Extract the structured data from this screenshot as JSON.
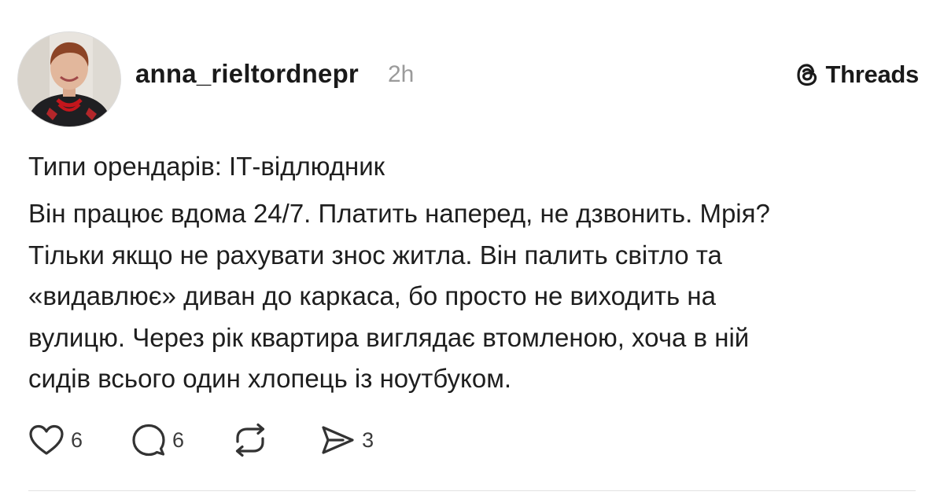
{
  "post": {
    "author": {
      "username": "anna_rieltordnepr",
      "time_ago": "2h"
    },
    "brand": {
      "label": "Threads",
      "icon": "threads-logo-icon"
    },
    "title": "Типи орендарів: ІТ-відлюдник",
    "body_lines": [
      "Він працює вдома 24/7. Платить наперед, не дзвонить. Мрія?",
      "Тільки якщо не рахувати знос житла. Він палить світло та",
      "«видавлює» диван до каркаса, бо просто не виходить на",
      "вулицю. Через рік квартира виглядає втомленою, хоча в ній",
      "сидів всього один хлопець із ноутбуком."
    ],
    "actions": {
      "like": {
        "icon": "heart-icon",
        "count": "6"
      },
      "comment": {
        "icon": "comment-bubble-icon",
        "count": "6"
      },
      "repost": {
        "icon": "repost-icon"
      },
      "share": {
        "icon": "send-icon",
        "count": "3"
      }
    }
  }
}
